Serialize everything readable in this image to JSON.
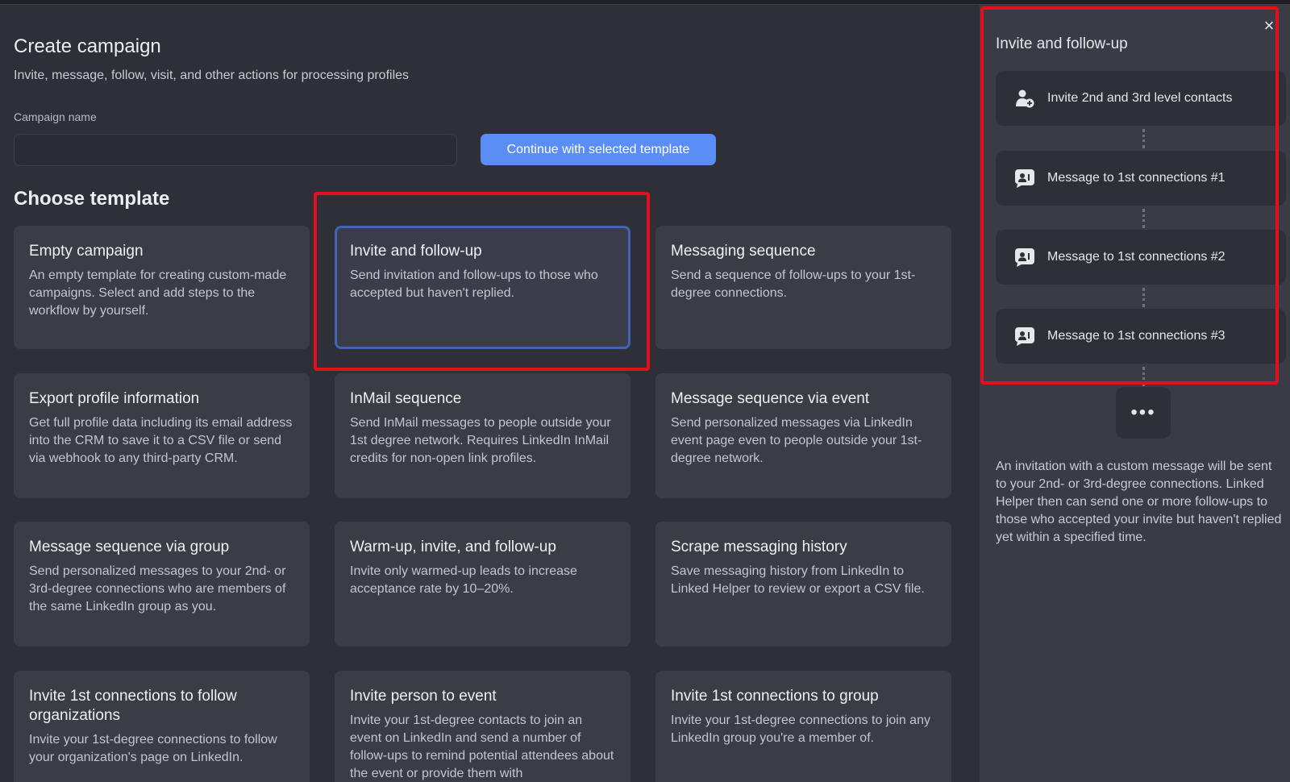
{
  "header": {
    "title": "Create campaign",
    "subtitle": "Invite, message, follow, visit, and other actions for processing profiles"
  },
  "form": {
    "name_label": "Campaign name",
    "name_value": "",
    "name_placeholder": "",
    "continue_label": "Continue with selected template"
  },
  "templates": {
    "heading": "Choose template",
    "items": [
      {
        "title": "Empty campaign",
        "desc": "An empty template for creating custom-made campaigns. Select and add steps to the workflow by yourself."
      },
      {
        "title": "Invite and follow-up",
        "desc": "Send invitation and follow-ups to those who accepted but haven't replied."
      },
      {
        "title": "Messaging sequence",
        "desc": "Send a sequence of follow-ups to your 1st-degree connections."
      },
      {
        "title": "Export profile information",
        "desc": "Get full profile data including its email address into the CRM to save it to a CSV file or send via webhook to any third-party CRM."
      },
      {
        "title": "InMail sequence",
        "desc": "Send InMail messages to people outside your 1st degree network. Requires LinkedIn InMail credits for non-open link profiles."
      },
      {
        "title": "Message sequence via event",
        "desc": "Send personalized messages via LinkedIn event page even to people outside your 1st-degree network."
      },
      {
        "title": "Message sequence via group",
        "desc": "Send personalized messages to your 2nd- or 3rd-degree connections who are members of the same LinkedIn group as you."
      },
      {
        "title": "Warm-up, invite, and follow-up",
        "desc": "Invite only warmed-up leads to increase acceptance rate by 10–20%."
      },
      {
        "title": "Scrape messaging history",
        "desc": "Save messaging history from LinkedIn to Linked Helper to review or export a CSV file."
      },
      {
        "title": "Invite 1st connections to follow organizations",
        "desc": "Invite your 1st-degree connections to follow your organization's page on LinkedIn."
      },
      {
        "title": "Invite person to event",
        "desc": "Invite your 1st-degree contacts to join an event on LinkedIn and send a number of follow-ups to remind potential attendees about the event or provide them with"
      },
      {
        "title": "Invite 1st connections to group",
        "desc": "Invite your 1st-degree connections to join any LinkedIn group you're a member of."
      }
    ]
  },
  "preview": {
    "title": "Invite and follow-up",
    "steps": [
      {
        "label": "Invite 2nd and 3rd level contacts",
        "icon": "add-user-icon"
      },
      {
        "label": "Message to 1st connections #1",
        "icon": "message-user-icon"
      },
      {
        "label": "Message to 1st connections #2",
        "icon": "message-user-icon"
      },
      {
        "label": "Message to 1st connections #3",
        "icon": "message-user-icon"
      }
    ],
    "more_label": "•••",
    "close_label": "×",
    "description": "An invitation with a custom message will be sent to your 2nd- or 3rd-degree connections. Linked Helper then can send one or more follow-ups to those who accepted your invite but haven't replied yet within a specified time."
  },
  "colors": {
    "accent": "#5b8df6",
    "highlight": "#e3101b",
    "selected_border": "#4064b8"
  }
}
